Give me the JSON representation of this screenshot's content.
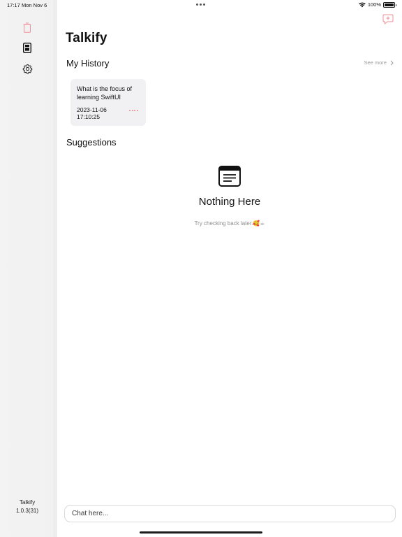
{
  "status_bar": {
    "time": "17:17",
    "date": "Mon Nov 6",
    "battery": "100%"
  },
  "sidebar": {
    "items": [
      {
        "name": "history",
        "icon": "trash-icon",
        "active": true
      },
      {
        "name": "prompts",
        "icon": "document-icon",
        "active": false
      },
      {
        "name": "settings",
        "icon": "gear-icon",
        "active": false
      }
    ],
    "footer_app_name": "Talkify",
    "footer_version": "1.0.3(31)"
  },
  "main": {
    "title": "Talkify",
    "history_section": {
      "title": "My History",
      "see_more_label": "See more",
      "items": [
        {
          "question": "What is the focus of learning SwiftUI",
          "date": "2023-11-06",
          "time": "17:10:25"
        }
      ]
    },
    "suggestions_section": {
      "title": "Suggestions",
      "empty_title": "Nothing Here",
      "empty_subtitle": "Try checking back later.🥰☕"
    },
    "chat_input": {
      "placeholder": "Chat here..."
    }
  },
  "colors": {
    "accent": "#e8838e",
    "card_background": "#f1f1f3",
    "sidebar_background": "#f2f2f2",
    "muted_text": "#8d8d8d"
  }
}
